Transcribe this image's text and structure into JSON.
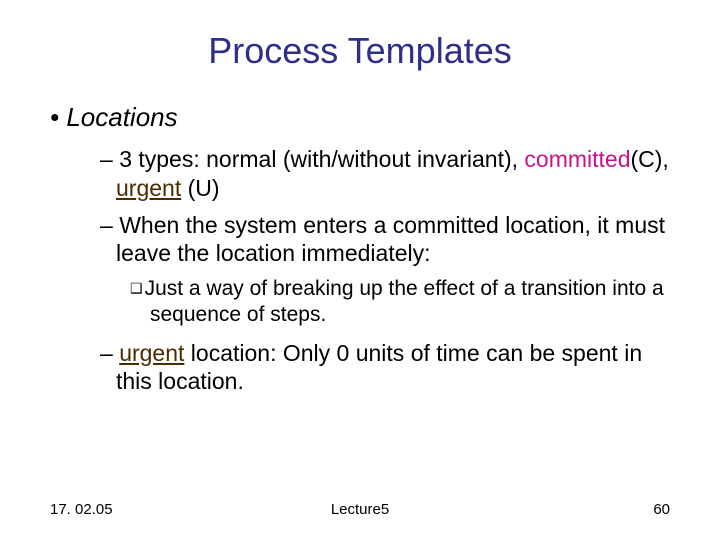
{
  "title": "Process Templates",
  "bullets": {
    "l1": "Locations",
    "sub1_pre": "3 types: normal (with/without invariant), ",
    "sub1_committed": "committed",
    "sub1_c": "(C), ",
    "sub1_urgent": "urgent",
    "sub1_u": " (U)",
    "sub2": "When the system enters a committed location, it must leave the location immediately:",
    "subsub": "Just a way of breaking up the effect of a transition into a sequence of steps.",
    "sub3_pre": "",
    "sub3_urgent": "urgent",
    "sub3_post": " location: Only 0 units of time can be spent in this location."
  },
  "footer": {
    "date": "17. 02.05",
    "center": "Lecture5",
    "page": "60"
  }
}
